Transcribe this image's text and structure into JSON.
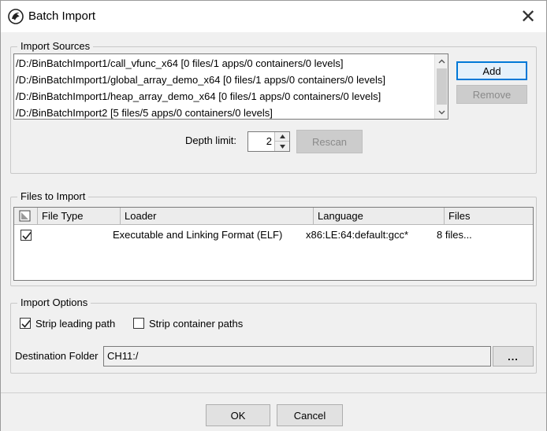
{
  "window": {
    "title": "Batch Import",
    "close_glyph": "✕"
  },
  "import_sources": {
    "title": "Import Sources",
    "items": [
      "/D:/BinBatchImport1/call_vfunc_x64 [0 files/1 apps/0 containers/0 levels]",
      "/D:/BinBatchImport1/global_array_demo_x64 [0 files/1 apps/0 containers/0 levels]",
      "/D:/BinBatchImport1/heap_array_demo_x64 [0 files/1 apps/0 containers/0 levels]",
      "/D:/BinBatchImport2 [5 files/5 apps/0 containers/0 levels]"
    ],
    "add_label": "Add",
    "remove_label": "Remove",
    "depth_label": "Depth limit:",
    "depth_value": "2",
    "rescan_label": "Rescan"
  },
  "files_to_import": {
    "title": "Files to Import",
    "columns": [
      "File Type",
      "Loader",
      "Language",
      "Files"
    ],
    "rows": [
      {
        "checked": true,
        "file_type": "",
        "loader": "Executable and Linking Format (ELF)",
        "language": "x86:LE:64:default:gcc*",
        "files": "8 files..."
      }
    ]
  },
  "import_options": {
    "title": "Import Options",
    "strip_leading_label": "Strip leading path",
    "strip_leading_checked": true,
    "strip_container_label": "Strip container paths",
    "strip_container_checked": false,
    "destination_label": "Destination Folder",
    "destination_value": "CH11:/",
    "browse_label": "..."
  },
  "footer": {
    "ok_label": "OK",
    "cancel_label": "Cancel"
  },
  "icons": {
    "app": "ghidra-dragon-icon",
    "sort_header": "checkbox-column-icon",
    "scroll_up": "chevron-up-icon",
    "scroll_down": "chevron-down-icon"
  },
  "colors": {
    "accent": "#0078d7",
    "dialog_bg": "#f0f0f0",
    "disabled_text": "#8a8a8a"
  }
}
